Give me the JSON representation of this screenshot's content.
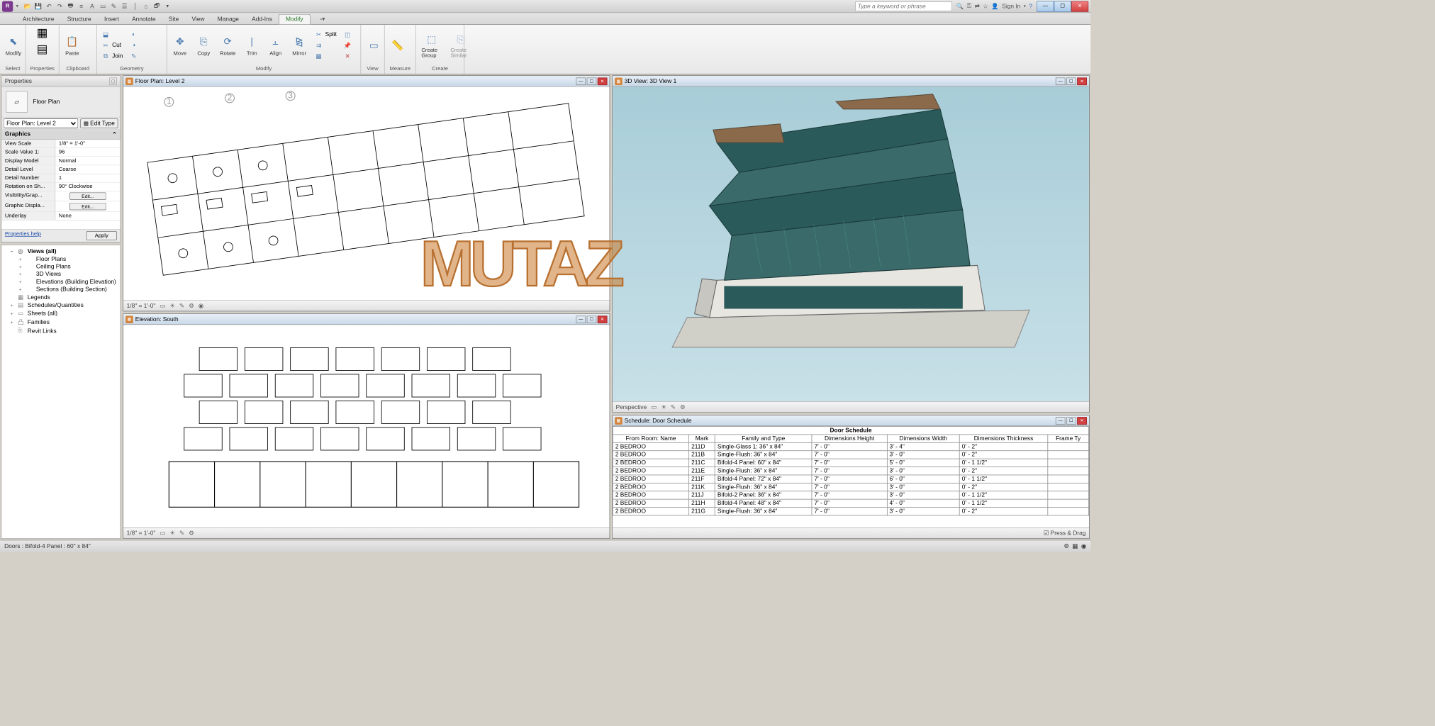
{
  "titlebar": {
    "search_placeholder": "Type a keyword or phrase",
    "signin": "Sign In"
  },
  "tabs": {
    "architecture": "Architecture",
    "structure": "Structure",
    "insert": "Insert",
    "annotate": "Annotate",
    "site": "Site",
    "view": "View",
    "manage": "Manage",
    "addins": "Add-Ins",
    "modify": "Modify"
  },
  "ribbon": {
    "select": "Select",
    "properties": "Properties",
    "clipboard": "Clipboard",
    "paste": "Paste",
    "geometry": "Geometry",
    "cut": "Cut",
    "join": "Join",
    "modify": "Modify",
    "move": "Move",
    "copy": "Copy",
    "rotate": "Rotate",
    "trim": "Trim",
    "align": "Align",
    "mirror": "Mirror",
    "split": "Split",
    "view": "View",
    "measure": "Measure",
    "create": "Create",
    "create_group": "Create Group",
    "create_similar": "Create Similar"
  },
  "properties_panel": {
    "title": "Properties",
    "element_type": "Floor Plan",
    "selector": "Floor Plan: Level 2",
    "edit_type": "Edit Type",
    "section_graphics": "Graphics",
    "rows": [
      {
        "k": "View Scale",
        "v": "1/8\" = 1'-0\""
      },
      {
        "k": "Scale Value    1:",
        "v": "96"
      },
      {
        "k": "Display Model",
        "v": "Normal"
      },
      {
        "k": "Detail Level",
        "v": "Coarse"
      },
      {
        "k": "Detail Number",
        "v": "1"
      },
      {
        "k": "Rotation on Sh...",
        "v": "90° Clockwise"
      },
      {
        "k": "Visibility/Grap...",
        "v": "__btn__Edit..."
      },
      {
        "k": "Graphic Displa...",
        "v": "__btn__Edit..."
      },
      {
        "k": "Underlay",
        "v": "None"
      }
    ],
    "help": "Properties help",
    "apply": "Apply"
  },
  "browser": {
    "items": [
      {
        "l": 1,
        "exp": "−",
        "ico": "◎",
        "label": "Views (all)",
        "bold": true
      },
      {
        "l": 2,
        "exp": "+",
        "ico": "",
        "label": "Floor Plans"
      },
      {
        "l": 2,
        "exp": "+",
        "ico": "",
        "label": "Ceiling Plans"
      },
      {
        "l": 2,
        "exp": "+",
        "ico": "",
        "label": "3D Views"
      },
      {
        "l": 2,
        "exp": "+",
        "ico": "",
        "label": "Elevations (Building Elevation)"
      },
      {
        "l": 2,
        "exp": "+",
        "ico": "",
        "label": "Sections (Building Section)"
      },
      {
        "l": 1,
        "exp": "",
        "ico": "▦",
        "label": "Legends"
      },
      {
        "l": 1,
        "exp": "+",
        "ico": "▤",
        "label": "Schedules/Quantities"
      },
      {
        "l": 1,
        "exp": "+",
        "ico": "▭",
        "label": "Sheets (all)"
      },
      {
        "l": 1,
        "exp": "+",
        "ico": "凸",
        "label": "Families"
      },
      {
        "l": 1,
        "exp": "",
        "ico": "⎘",
        "label": "Revit Links"
      }
    ]
  },
  "views": {
    "floorplan": {
      "title": "Floor Plan: Level 2",
      "scale": "1/8\" = 1'-0\""
    },
    "elevation": {
      "title": "Elevation: South",
      "scale": "1/8\" = 1'-0\""
    },
    "view3d": {
      "title": "3D View: 3D View 1",
      "mode": "Perspective"
    },
    "schedule": {
      "title": "Schedule: Door Schedule",
      "table_title": "Door Schedule"
    }
  },
  "schedule": {
    "headers": [
      "From Room: Name",
      "Mark",
      "Family and Type",
      "Dimensions Height",
      "Dimensions Width",
      "Dimensions Thickness",
      "Frame Ty"
    ],
    "rows": [
      [
        "2 BEDROO",
        "211D",
        "Single-Glass 1: 36\" x 84\"",
        "7' - 0\"",
        "3' - 4\"",
        "0' - 2\"",
        ""
      ],
      [
        "2 BEDROO",
        "211B",
        "Single-Flush: 36\" x 84\"",
        "7' - 0\"",
        "3' - 0\"",
        "0' - 2\"",
        ""
      ],
      [
        "2 BEDROO",
        "211C",
        "Bifold-4 Panel: 60\" x 84\"",
        "7' - 0\"",
        "5' - 0\"",
        "0' - 1 1/2\"",
        ""
      ],
      [
        "2 BEDROO",
        "211E",
        "Single-Flush: 36\" x 84\"",
        "7' - 0\"",
        "3' - 0\"",
        "0' - 2\"",
        ""
      ],
      [
        "2 BEDROO",
        "211F",
        "Bifold-4 Panel: 72\" x 84\"",
        "7' - 0\"",
        "6' - 0\"",
        "0' - 1 1/2\"",
        ""
      ],
      [
        "2 BEDROO",
        "211K",
        "Single-Flush: 36\" x 84\"",
        "7' - 0\"",
        "3' - 0\"",
        "0' - 2\"",
        ""
      ],
      [
        "2 BEDROO",
        "211J",
        "Bifold-2 Panel: 36\" x 84\"",
        "7' - 0\"",
        "3' - 0\"",
        "0' - 1 1/2\"",
        ""
      ],
      [
        "2 BEDROO",
        "211H",
        "Bifold-4 Panel: 48\" x 84\"",
        "7' - 0\"",
        "4' - 0\"",
        "0' - 1 1/2\"",
        ""
      ],
      [
        "2 BEDROO",
        "211G",
        "Single-Flush: 36\" x 84\"",
        "7' - 0\"",
        "3' - 0\"",
        "0' - 2\"",
        ""
      ]
    ],
    "footer": "Press & Drag"
  },
  "statusbar": {
    "left": "Doors : Bifold-4 Panel : 60\" x 84\""
  },
  "watermark": "MUTAZ"
}
